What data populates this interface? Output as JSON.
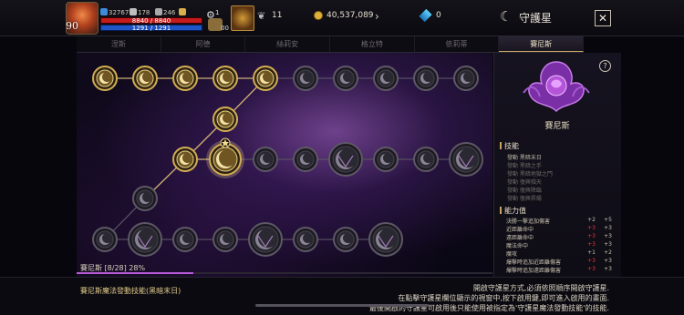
{
  "header": {
    "level": "90",
    "power": "32767",
    "attack": "178",
    "defense": "246",
    "hp": "8840 / 8840",
    "mp": "1291 / 1291",
    "gear_count": "1",
    "bag_count": "00",
    "feathers": "11",
    "gold": "40,537,089",
    "gems": "0",
    "title": "守護星",
    "close": "✕"
  },
  "tabs": [
    {
      "label": "涅斯"
    },
    {
      "label": "阿德"
    },
    {
      "label": "絲莉安"
    },
    {
      "label": "格立特"
    },
    {
      "label": "依莉蒂"
    },
    {
      "label": "賽尼斯"
    }
  ],
  "board": {
    "progress_text": "賽尼斯 [8/28] 28%",
    "progress": 0.28
  },
  "panel": {
    "help": "?",
    "name": "賽尼斯",
    "skills_title": "技能",
    "skills": [
      {
        "label": "發動 黑暗末日",
        "active": true
      },
      {
        "label": "發動 黑暗之手",
        "active": false
      },
      {
        "label": "發動 黑暗地獄之門",
        "active": false
      },
      {
        "label": "發動 復興殞天",
        "active": false
      },
      {
        "label": "發動 復興降臨",
        "active": false
      },
      {
        "label": "發動 復興昇陽",
        "active": false
      }
    ],
    "ability_title": "能力值",
    "abilities": [
      {
        "name": "決勝一擊追加傷害",
        "a": "+2",
        "b": "+5",
        "a_red": false
      },
      {
        "name": "近距離命中",
        "a": "+3",
        "b": "+3",
        "a_red": true
      },
      {
        "name": "遠距離命中",
        "a": "+3",
        "b": "+3",
        "a_red": true
      },
      {
        "name": "魔法命中",
        "a": "+3",
        "b": "+3",
        "a_red": true
      },
      {
        "name": "魔攻",
        "a": "+1",
        "b": "+2",
        "a_red": false
      },
      {
        "name": "爆擊時追加近距離傷害",
        "a": "+3",
        "b": "+3",
        "a_red": true
      },
      {
        "name": "爆擊時追加遠距離傷害",
        "a": "+3",
        "b": "+3",
        "a_red": true
      }
    ]
  },
  "footer": {
    "left": "賽尼斯魔法發動技能(黑暗末日)",
    "right_lines": [
      "開啟守護星方式,必須依照順序開啟守護星.",
      "在點擊守護星欄位顯示的視窗中,按下啟用鍵,即可進入啟用的畫面.",
      "最後開啟的守護星可啟用後只能使用被指定為'守護星魔法發動技能'的技能."
    ]
  },
  "colors": {
    "accent_purple": "#b85bd6",
    "gold_node": "#c9a23e",
    "active_tab_line": "#c8a86a"
  }
}
